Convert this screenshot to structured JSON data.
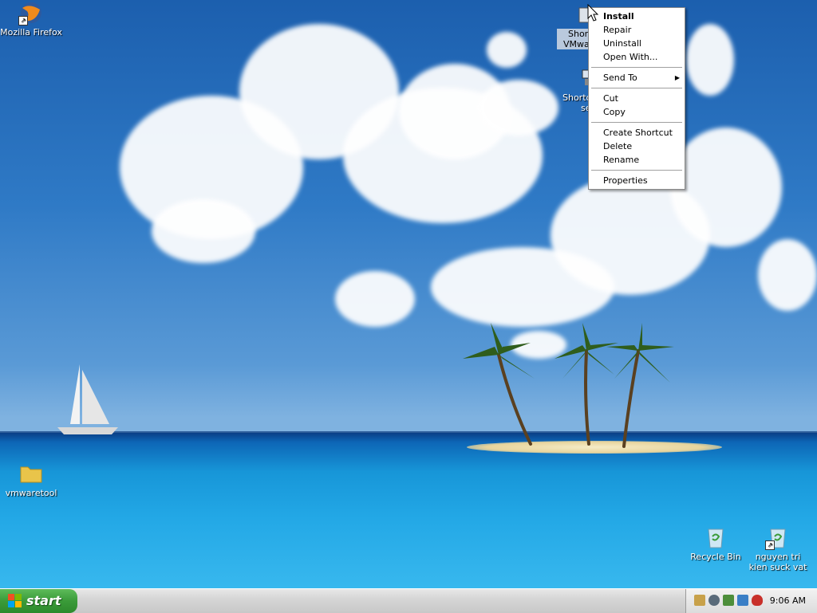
{
  "desktop": {
    "icons": {
      "firefox": "Mozilla Firefox",
      "vmwaretool": "vmwaretool",
      "shortcut1_line1": "Short",
      "shortcut1_line2": "VMwar",
      "shortcut2_line1": "Shortc",
      "shortcut2_line2": "se",
      "recycle_bin": "Recycle Bin",
      "user_bin": "nguyen tri kien suck vat"
    }
  },
  "context_menu": {
    "install": "Install",
    "repair": "Repair",
    "uninstall": "Uninstall",
    "open_with": "Open With...",
    "send_to": "Send To",
    "cut": "Cut",
    "copy": "Copy",
    "create_shortcut": "Create Shortcut",
    "delete": "Delete",
    "rename": "Rename",
    "properties": "Properties"
  },
  "taskbar": {
    "start_label": "start",
    "clock": "9:06 AM"
  },
  "colors": {
    "start_green": "#3a9b39",
    "selection": "#b9c9dd"
  }
}
